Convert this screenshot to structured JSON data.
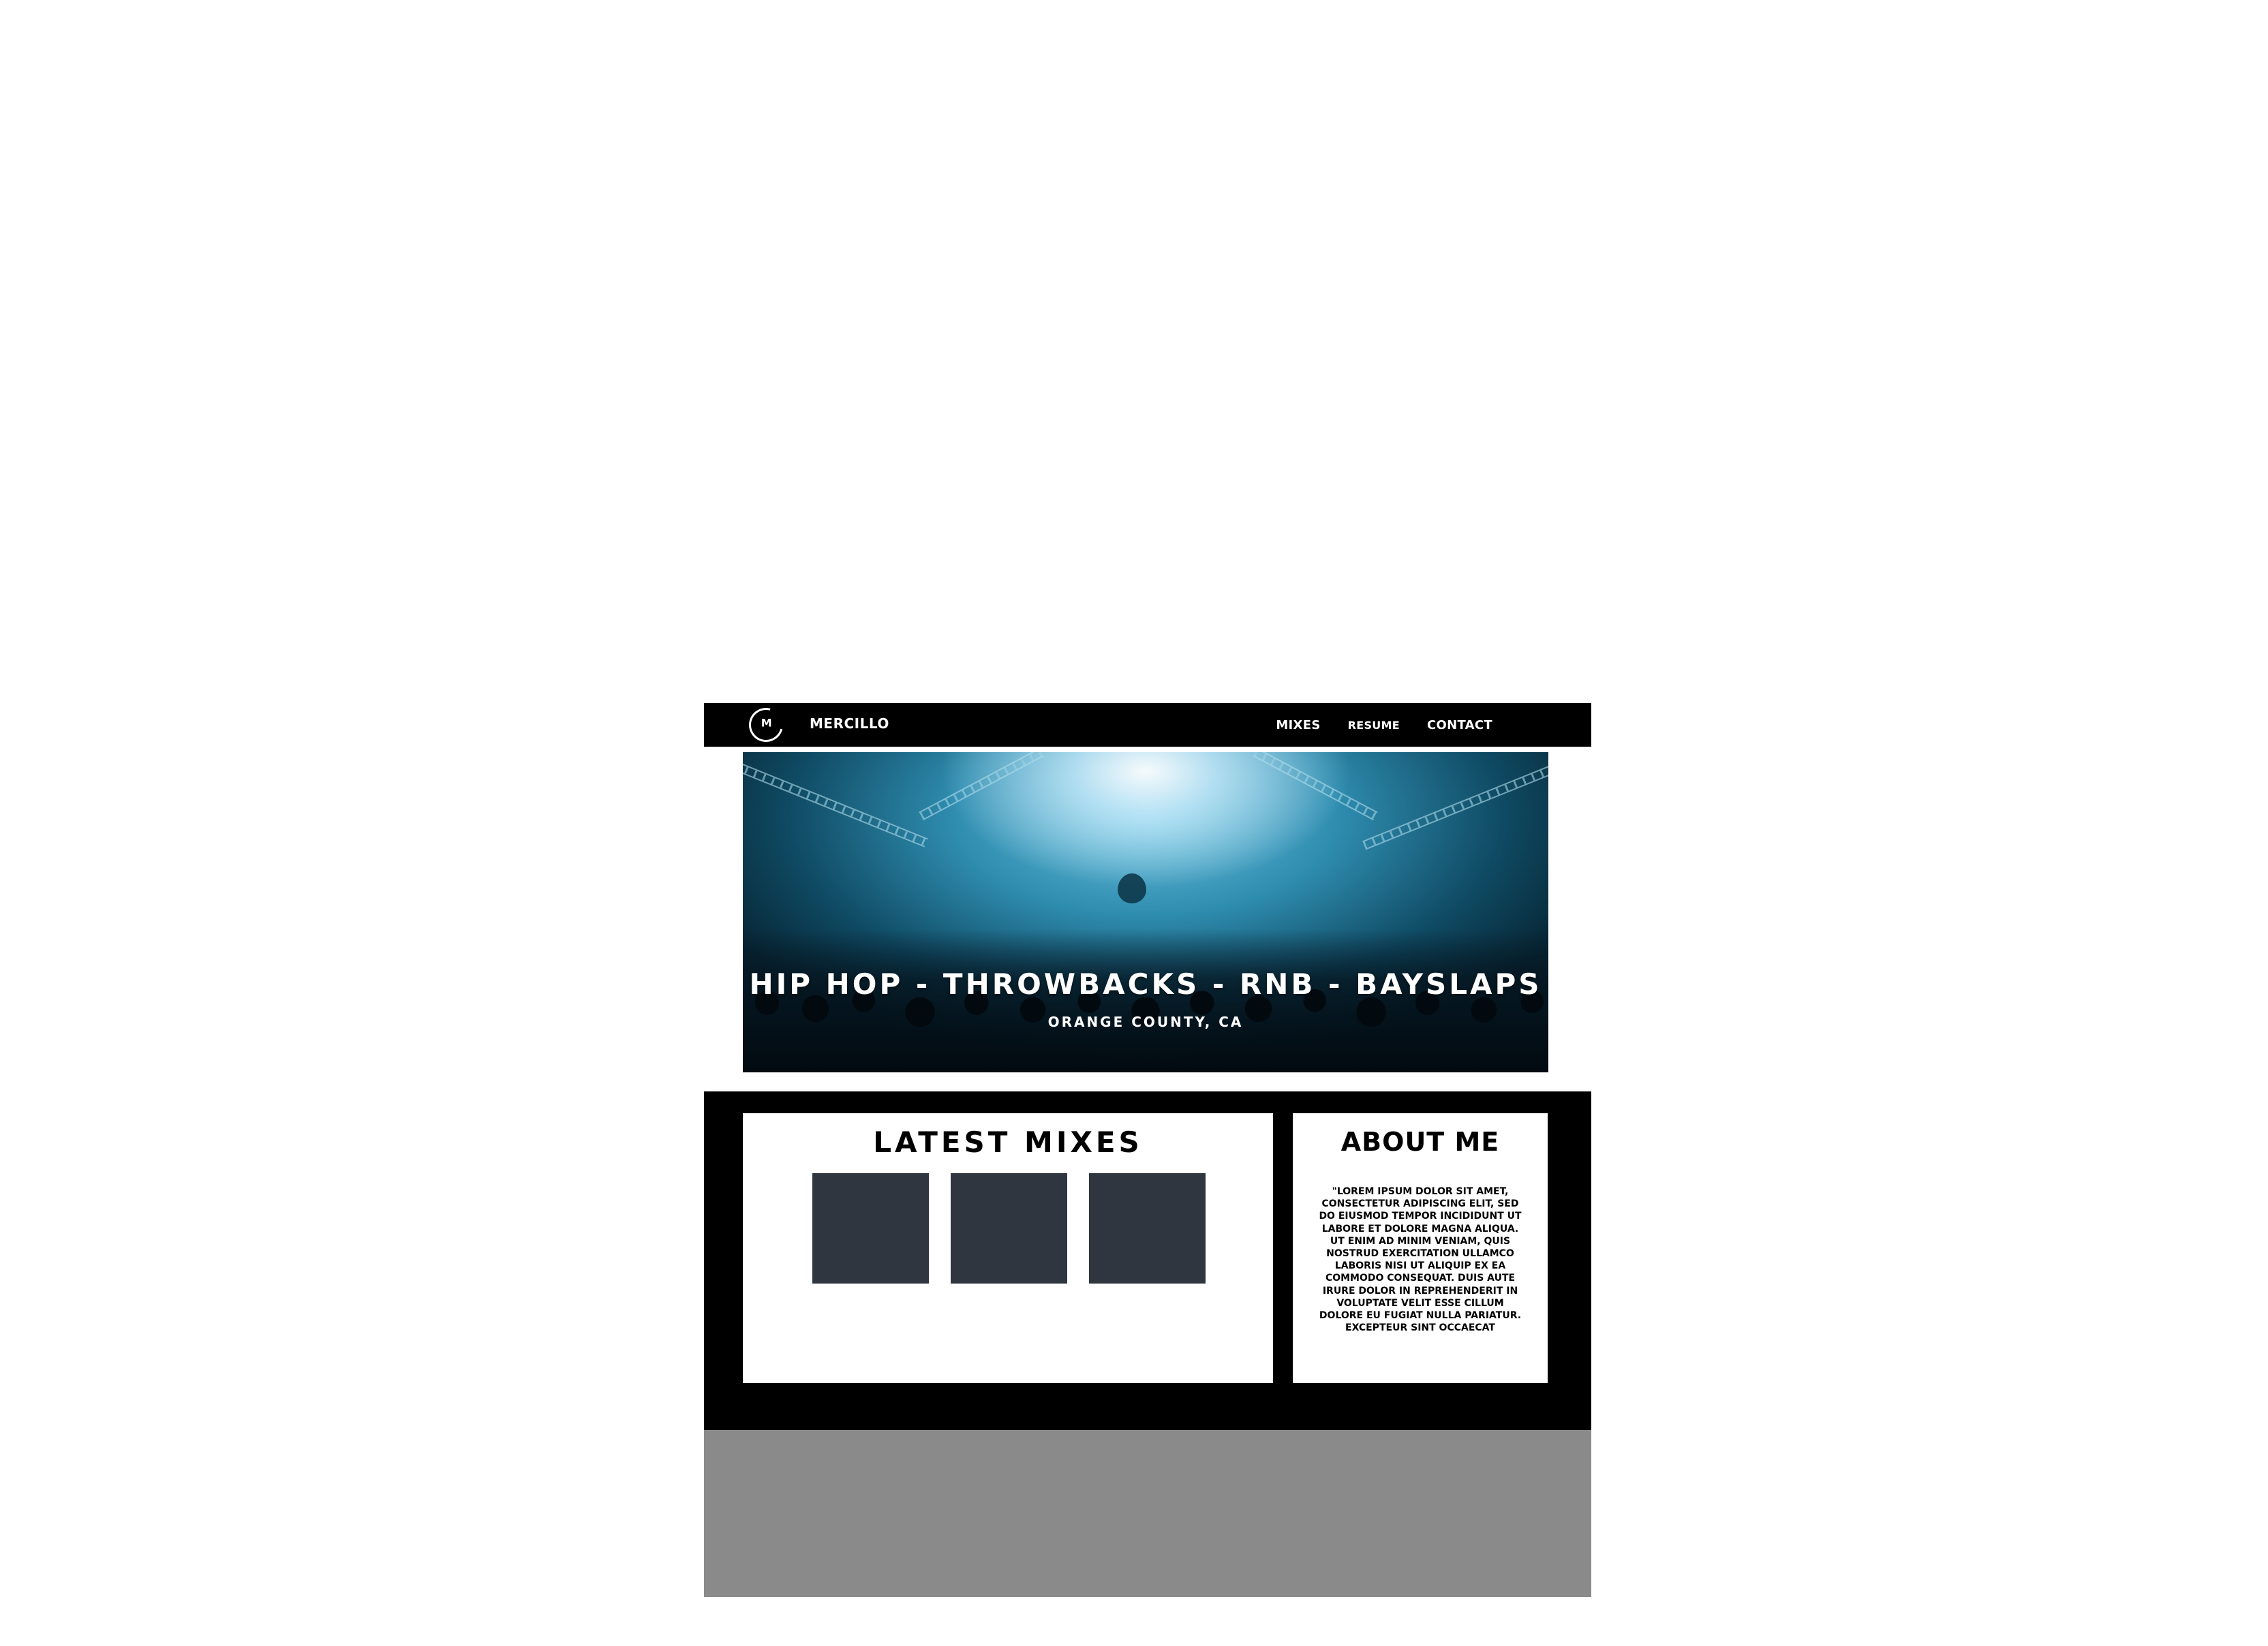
{
  "navbar": {
    "brand": "MERCILLO",
    "logo_glyph": "M",
    "links": [
      {
        "label": "MIXES"
      },
      {
        "label": "RESUME"
      },
      {
        "label": "CONTACT"
      }
    ]
  },
  "hero": {
    "title": "HIP HOP - THROWBACKS - RNB - BAYSLAPS",
    "subtitle": "ORANGE COUNTY, CA"
  },
  "mixes": {
    "heading": "LATEST MIXES",
    "tile_color": "#2f3640"
  },
  "about": {
    "heading": "ABOUT ME",
    "text": "\"Lorem ipsum dolor sit amet, consectetur adipiscing elit, sed do eiusmod tempor incididunt ut labore et dolore magna aliqua. Ut enim ad minim veniam, quis nostrud exercitation ullamco laboris nisi ut aliquip ex ea commodo consequat. Duis aute irure dolor in reprehenderit in voluptate velit esse cillum dolore eu fugiat nulla pariatur. Excepteur sint occaecat"
  },
  "colors": {
    "navbar_bg": "#000000",
    "content_bg": "#000000",
    "footer_bg": "#8a8a8a",
    "hero_accent": "#2f8db0"
  }
}
